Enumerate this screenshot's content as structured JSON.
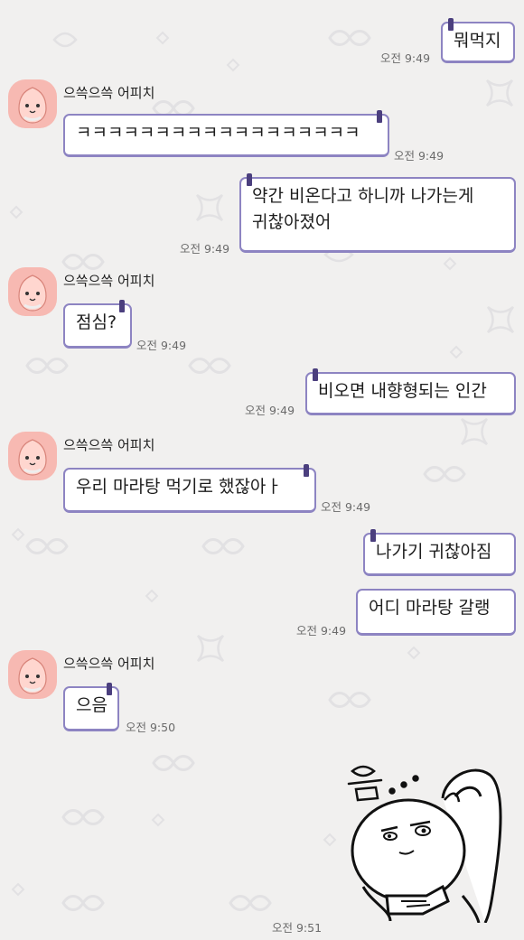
{
  "chat": {
    "contact": {
      "name": "으쓱으쓱 어피치",
      "avatar_icon": "apeach-avatar-icon"
    },
    "messages": [
      {
        "from": "me",
        "text": "뭐먹지",
        "time": "오전 9:49"
      },
      {
        "from": "them",
        "text": "ㅋㅋㅋㅋㅋㅋㅋㅋㅋㅋㅋㅋㅋㅋㅋㅋㅋㅋ",
        "time": "오전 9:49"
      },
      {
        "from": "me",
        "text_line1": "약간 비온다고 하니까 나가는게",
        "text_line2": "귀찮아졌어",
        "time": "오전 9:49"
      },
      {
        "from": "them",
        "text": "점심?",
        "time": "오전 9:49"
      },
      {
        "from": "me",
        "text": "비오면 내향형되는 인간",
        "time": "오전 9:49"
      },
      {
        "from": "them",
        "text": "우리 마라탕 먹기로 했잖아ㅏ",
        "time": "오전 9:49"
      },
      {
        "from": "me",
        "text": "나가기 귀찮아짐"
      },
      {
        "from": "me",
        "text": "어디 마라탕 갈랭",
        "time": "오전 9:49"
      },
      {
        "from": "them",
        "text": "으음",
        "time": "오전 9:50"
      },
      {
        "from": "me",
        "sticker": "apeach-thinking-sticker-icon",
        "sticker_text": "음...",
        "time": "오전 9:51"
      }
    ]
  },
  "theme": {
    "bubble_border": "#8d84c2",
    "bubble_tab": "#4b3f7e",
    "background": "#f1f0ef",
    "avatar_color": "#f7b9b2"
  }
}
